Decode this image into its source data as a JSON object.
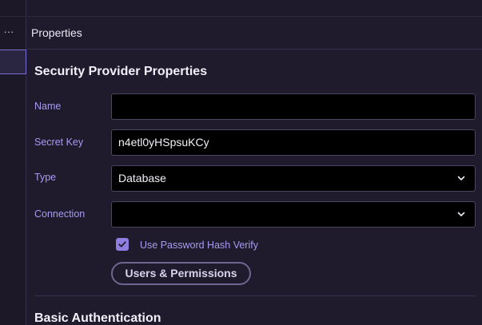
{
  "panel": {
    "header_title": "Properties"
  },
  "section": {
    "title": "Security Provider Properties"
  },
  "fields": {
    "name": {
      "label": "Name",
      "value": ""
    },
    "secret_key": {
      "label": "Secret Key",
      "value": "n4etl0yHSpsuKCy"
    },
    "type": {
      "label": "Type",
      "value": "Database"
    },
    "connection": {
      "label": "Connection",
      "value": ""
    }
  },
  "options": {
    "use_password_hash_verify": {
      "label": "Use Password Hash Verify",
      "checked": true
    }
  },
  "buttons": {
    "users_permissions": "Users & Permissions"
  },
  "next_section": {
    "title": "Basic Authentication"
  },
  "colors": {
    "background": "#1f1b2c",
    "accent": "#8d7ee0",
    "label": "#a69cf0",
    "input_bg": "#000000"
  },
  "icons": {
    "more": "more-horizontal-icon",
    "chevron": "chevron-down-icon",
    "check": "check-icon"
  }
}
